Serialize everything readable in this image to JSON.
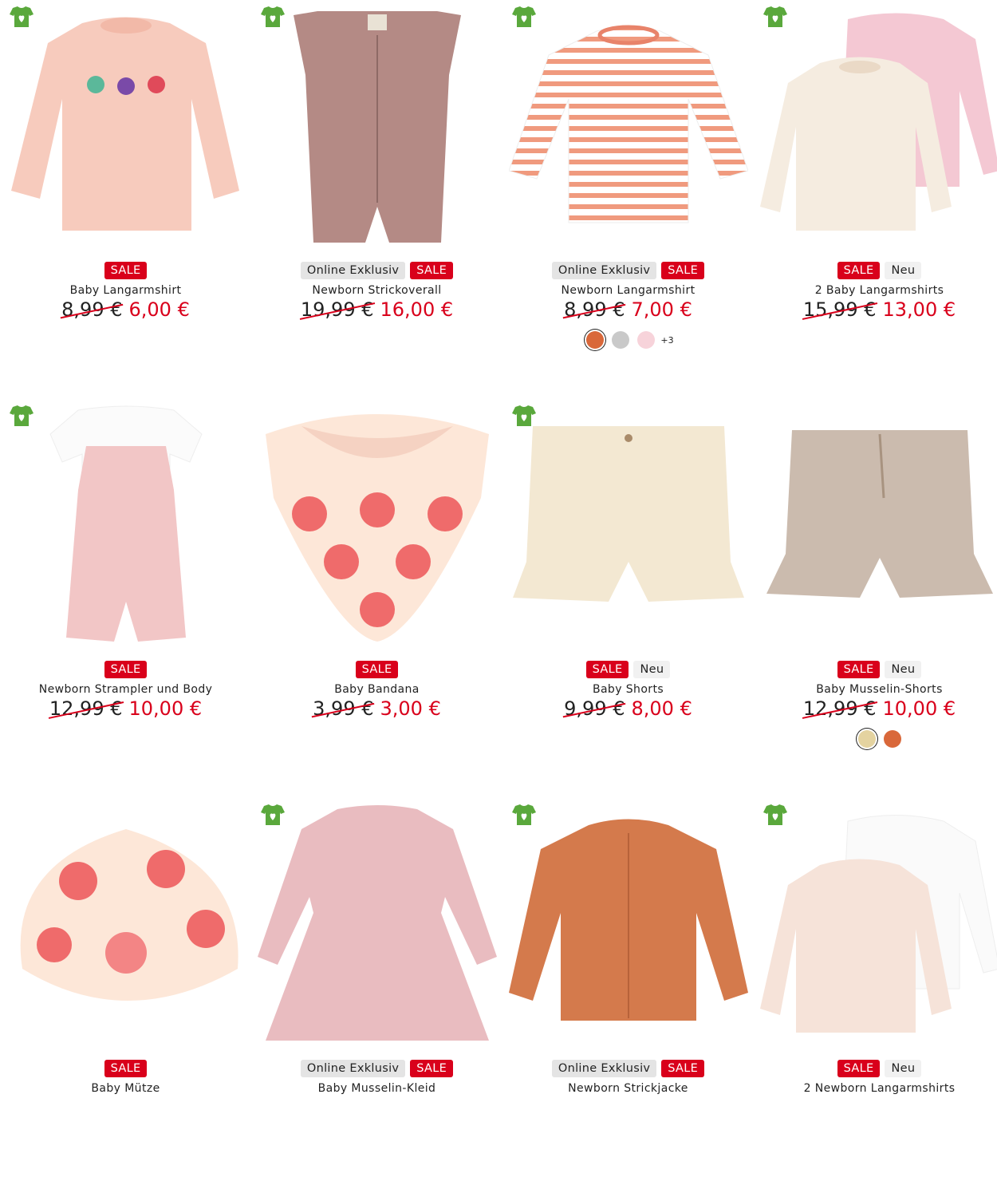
{
  "colors": {
    "sale": "#d9001b",
    "eco": "#5aa83c",
    "text": "#222222"
  },
  "products": [
    {
      "badges": [
        "SALE"
      ],
      "name": "Baby Langarmshirt",
      "old_price": "8,99 €",
      "new_price": "6,00 €",
      "eco_icon": "eco-shirt-heart-icon",
      "swatches": [],
      "more": ""
    },
    {
      "badges": [
        "Online Exklusiv",
        "SALE"
      ],
      "name": "Newborn Strickoverall",
      "old_price": "19,99 €",
      "new_price": "16,00 €",
      "eco_icon": "eco-shirt-heart-icon",
      "swatches": [],
      "more": ""
    },
    {
      "badges": [
        "Online Exklusiv",
        "SALE"
      ],
      "name": "Newborn Langarmshirt",
      "old_price": "8,99 €",
      "new_price": "7,00 €",
      "eco_icon": "eco-shirt-heart-icon",
      "swatches": [
        "#d9683a",
        "#c9c9c9",
        "#f7d3da"
      ],
      "more": "+3"
    },
    {
      "badges": [
        "SALE",
        "Neu"
      ],
      "name": "2 Baby Langarmshirts",
      "old_price": "15,99 €",
      "new_price": "13,00 €",
      "eco_icon": "eco-shirt-heart-icon",
      "swatches": [],
      "more": ""
    },
    {
      "badges": [
        "SALE"
      ],
      "name": "Newborn Strampler und Body",
      "old_price": "12,99 €",
      "new_price": "10,00 €",
      "eco_icon": "eco-shirt-heart-icon",
      "swatches": [],
      "more": ""
    },
    {
      "badges": [
        "SALE"
      ],
      "name": "Baby Bandana",
      "old_price": "3,99 €",
      "new_price": "3,00 €",
      "eco_icon": "",
      "swatches": [],
      "more": ""
    },
    {
      "badges": [
        "SALE",
        "Neu"
      ],
      "name": "Baby Shorts",
      "old_price": "9,99 €",
      "new_price": "8,00 €",
      "eco_icon": "eco-shirt-heart-icon",
      "swatches": [],
      "more": ""
    },
    {
      "badges": [
        "SALE",
        "Neu"
      ],
      "name": "Baby Musselin-Shorts",
      "old_price": "12,99 €",
      "new_price": "10,00 €",
      "eco_icon": "",
      "swatches": [
        "#e4d3a0",
        "#d9683a"
      ],
      "more": ""
    },
    {
      "badges": [
        "SALE"
      ],
      "name": "Baby Mütze",
      "old_price": "",
      "new_price": "",
      "eco_icon": "",
      "swatches": [],
      "more": ""
    },
    {
      "badges": [
        "Online Exklusiv",
        "SALE"
      ],
      "name": "Baby Musselin-Kleid",
      "old_price": "",
      "new_price": "",
      "eco_icon": "eco-shirt-heart-icon",
      "swatches": [],
      "more": ""
    },
    {
      "badges": [
        "Online Exklusiv",
        "SALE"
      ],
      "name": "Newborn Strickjacke",
      "old_price": "",
      "new_price": "",
      "eco_icon": "eco-shirt-heart-icon",
      "swatches": [],
      "more": ""
    },
    {
      "badges": [
        "SALE",
        "Neu"
      ],
      "name": "2 Newborn Langarmshirts",
      "old_price": "",
      "new_price": "",
      "eco_icon": "eco-shirt-heart-icon",
      "swatches": [],
      "more": ""
    }
  ]
}
